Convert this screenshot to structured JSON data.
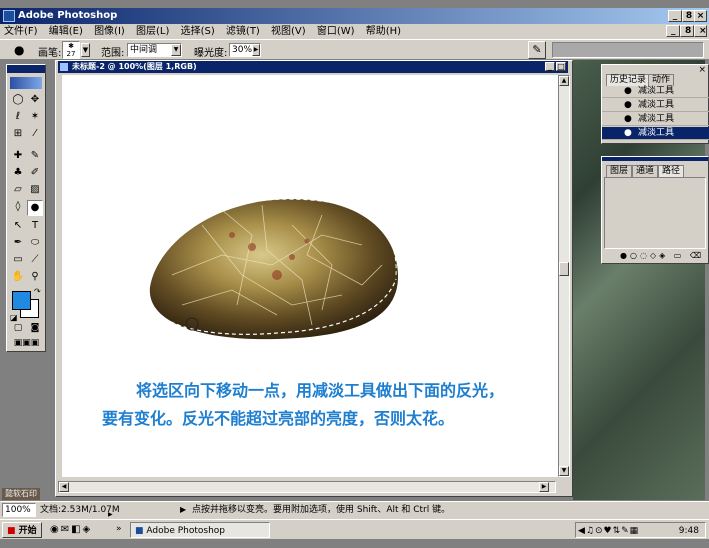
{
  "window": {
    "title": "Adobe Photoshop",
    "min_label": "_",
    "max_label": "8",
    "close_label": "×"
  },
  "menubar": {
    "items": [
      "文件(F)",
      "编辑(E)",
      "图像(I)",
      "图层(L)",
      "选择(S)",
      "滤镜(T)",
      "视图(V)",
      "窗口(W)",
      "帮助(H)"
    ],
    "min_label": "_",
    "max_label": "8",
    "close_label": "×"
  },
  "options": {
    "brush_label": "画笔:",
    "brush_size": "27",
    "range_label": "范围:",
    "range_value": "中间调",
    "exposure_label": "曝光度:",
    "exposure_value": "30%"
  },
  "document": {
    "title": "未标题-2 @ 100%(图层 1,RGB)",
    "caption_line1": "将选区向下移动一点，用减淡工具做出下面的反光，",
    "caption_line2": "要有变化。反光不能超过亮部的亮度，否则太花。"
  },
  "history_palette": {
    "tabs": [
      "历史记录",
      "动作"
    ],
    "items": [
      "减淡工具",
      "减淡工具",
      "减淡工具",
      "减淡工具"
    ],
    "selected_index": 3
  },
  "layers_palette": {
    "tabs": [
      "图层",
      "通道",
      "路径"
    ]
  },
  "status": {
    "zoom": "100%",
    "doc_size": "文档:2.53M/1.07M",
    "hint": "点按并拖移以变亮。要用附加选项，使用 Shift、Alt 和 Ctrl 键。",
    "watermark": "懿软石印"
  },
  "taskbar": {
    "start_label": "开始",
    "active_task": "Adobe Photoshop",
    "clock": "9:48",
    "quick_launch_more": "»"
  },
  "colors": {
    "title_bar": "#0a246a",
    "caption_text": "#1e7fd0",
    "foreground_swatch": "#1f8ae0",
    "background_swatch": "#ffffff"
  }
}
